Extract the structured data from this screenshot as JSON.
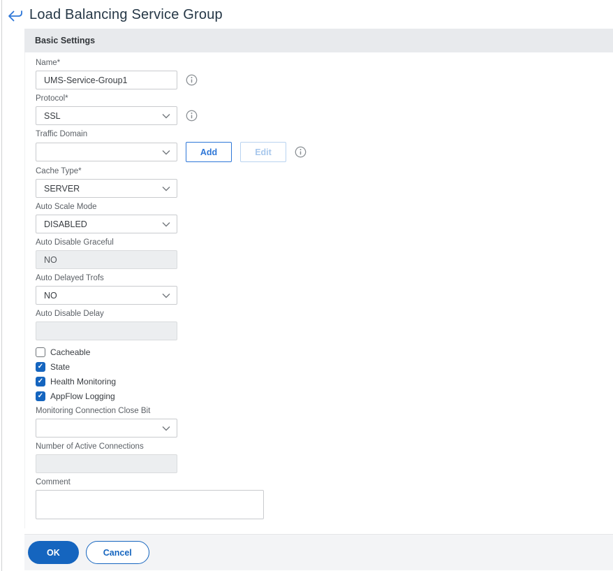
{
  "header": {
    "title": "Load Balancing Service Group"
  },
  "panel": {
    "section_title": "Basic Settings"
  },
  "fields": {
    "name": {
      "label": "Name*",
      "value": "UMS-Service-Group1",
      "type": "text"
    },
    "protocol": {
      "label": "Protocol*",
      "value": "SSL",
      "type": "select"
    },
    "traffic_domain": {
      "label": "Traffic Domain",
      "value": "",
      "type": "select",
      "add_label": "Add",
      "edit_label": "Edit",
      "edit_disabled": true
    },
    "cache_type": {
      "label": "Cache Type*",
      "value": "SERVER",
      "type": "select"
    },
    "auto_scale_mode": {
      "label": "Auto Scale Mode",
      "value": "DISABLED",
      "type": "select"
    },
    "auto_disable_graceful": {
      "label": "Auto Disable Graceful",
      "value": "NO",
      "type": "text-disabled"
    },
    "auto_delayed_trofs": {
      "label": "Auto Delayed Trofs",
      "value": "NO",
      "type": "select"
    },
    "auto_disable_delay": {
      "label": "Auto Disable Delay",
      "value": "",
      "type": "text-disabled"
    },
    "monitoring_connection_close_bit": {
      "label": "Monitoring Connection Close Bit",
      "value": "",
      "type": "select"
    },
    "number_of_active_connections": {
      "label": "Number of Active Connections",
      "value": "",
      "type": "text-disabled"
    },
    "comment": {
      "label": "Comment",
      "value": "",
      "type": "textarea"
    }
  },
  "checkboxes": [
    {
      "label": "Cacheable",
      "checked": false
    },
    {
      "label": "State",
      "checked": true
    },
    {
      "label": "Health Monitoring",
      "checked": true
    },
    {
      "label": "AppFlow Logging",
      "checked": true
    }
  ],
  "footer": {
    "ok_label": "OK",
    "cancel_label": "Cancel"
  },
  "colors": {
    "accent_blue": "#1565BF",
    "outline_button_blue": "#2E77D8",
    "title_text": "#253746",
    "label_text": "#5B6066",
    "section_header_bg": "#E8EAED",
    "footer_bg": "#F3F4F6",
    "disabled_input_bg": "#ECEEF0",
    "input_border": "#C9CBCE"
  },
  "icons": {
    "back": "back-arrow-icon",
    "info": "info-icon",
    "chevron": "chevron-down-icon",
    "check": "check-mark-icon"
  }
}
